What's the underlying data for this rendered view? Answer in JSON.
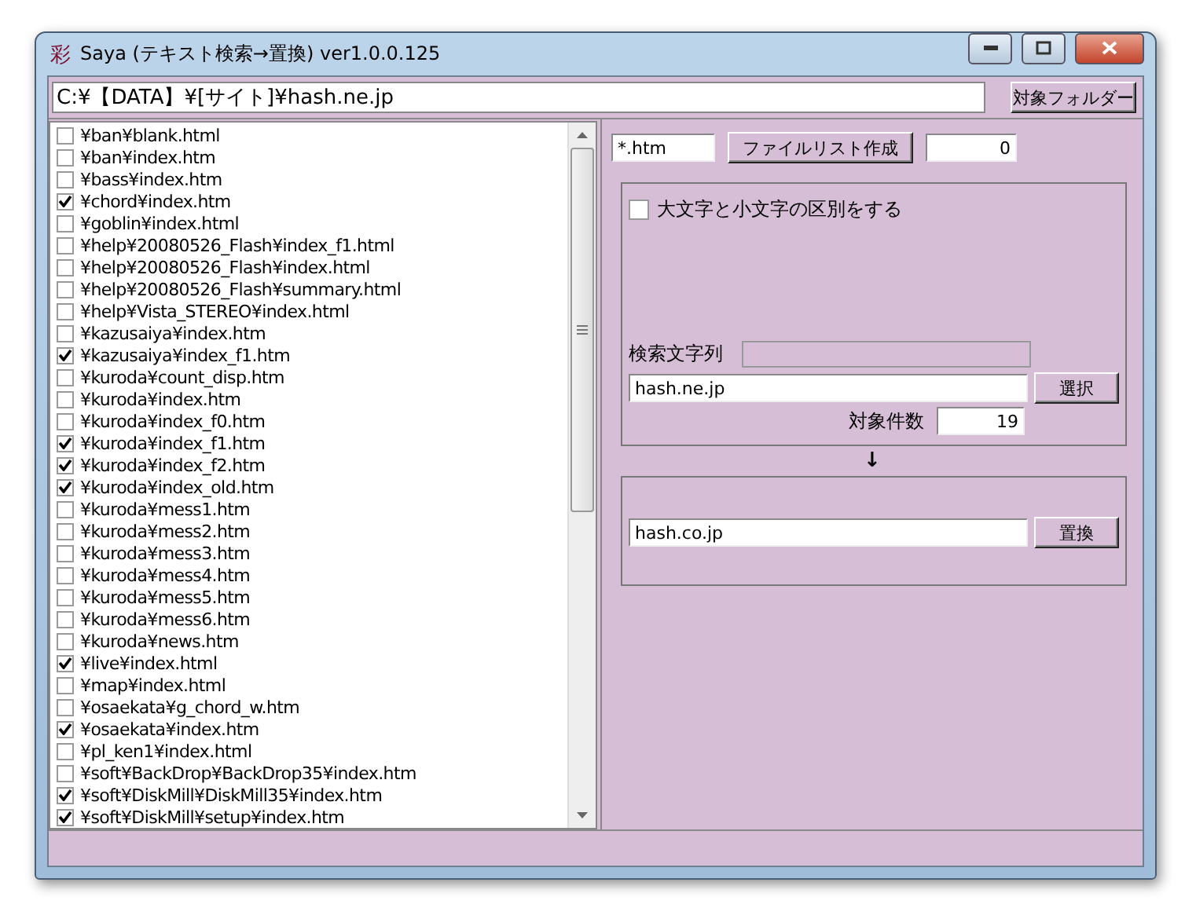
{
  "window": {
    "icon": "彩",
    "title": "Saya (テキスト検索→置換) ver1.0.0.125"
  },
  "path": {
    "value": "C:¥【DATA】¥[サイト]¥hash.ne.jp",
    "button": "対象フォルダー"
  },
  "files": [
    {
      "name": "¥ban¥blank.html",
      "checked": false
    },
    {
      "name": "¥ban¥index.htm",
      "checked": false
    },
    {
      "name": "¥bass¥index.htm",
      "checked": false
    },
    {
      "name": "¥chord¥index.htm",
      "checked": true
    },
    {
      "name": "¥goblin¥index.html",
      "checked": false
    },
    {
      "name": "¥help¥20080526_Flash¥index_f1.html",
      "checked": false
    },
    {
      "name": "¥help¥20080526_Flash¥index.html",
      "checked": false
    },
    {
      "name": "¥help¥20080526_Flash¥summary.html",
      "checked": false
    },
    {
      "name": "¥help¥Vista_STEREO¥index.html",
      "checked": false
    },
    {
      "name": "¥kazusaiya¥index.htm",
      "checked": false
    },
    {
      "name": "¥kazusaiya¥index_f1.htm",
      "checked": true
    },
    {
      "name": "¥kuroda¥count_disp.htm",
      "checked": false
    },
    {
      "name": "¥kuroda¥index.htm",
      "checked": false
    },
    {
      "name": "¥kuroda¥index_f0.htm",
      "checked": false
    },
    {
      "name": "¥kuroda¥index_f1.htm",
      "checked": true
    },
    {
      "name": "¥kuroda¥index_f2.htm",
      "checked": true
    },
    {
      "name": "¥kuroda¥index_old.htm",
      "checked": true
    },
    {
      "name": "¥kuroda¥mess1.htm",
      "checked": false
    },
    {
      "name": "¥kuroda¥mess2.htm",
      "checked": false
    },
    {
      "name": "¥kuroda¥mess3.htm",
      "checked": false
    },
    {
      "name": "¥kuroda¥mess4.htm",
      "checked": false
    },
    {
      "name": "¥kuroda¥mess5.htm",
      "checked": false
    },
    {
      "name": "¥kuroda¥mess6.htm",
      "checked": false
    },
    {
      "name": "¥kuroda¥news.htm",
      "checked": false
    },
    {
      "name": "¥live¥index.html",
      "checked": true
    },
    {
      "name": "¥map¥index.html",
      "checked": false
    },
    {
      "name": "¥osaekata¥g_chord_w.htm",
      "checked": false
    },
    {
      "name": "¥osaekata¥index.htm",
      "checked": true
    },
    {
      "name": "¥pl_ken1¥index.html",
      "checked": false
    },
    {
      "name": "¥soft¥BackDrop¥BackDrop35¥index.htm",
      "checked": false
    },
    {
      "name": "¥soft¥DiskMill¥DiskMill35¥index.htm",
      "checked": true
    },
    {
      "name": "¥soft¥DiskMill¥setup¥index.htm",
      "checked": true
    }
  ],
  "filelist": {
    "pattern": "*.htm",
    "button": "ファイルリスト作成",
    "count": "0"
  },
  "search": {
    "case_label": "大文字と小文字の区別をする",
    "case_checked": false,
    "label": "検索文字列",
    "value": "hash.ne.jp",
    "button": "選択",
    "count_label": "対象件数",
    "count": "19"
  },
  "arrow": "↓",
  "replace": {
    "value": "hash.co.jp",
    "button": "置換"
  }
}
